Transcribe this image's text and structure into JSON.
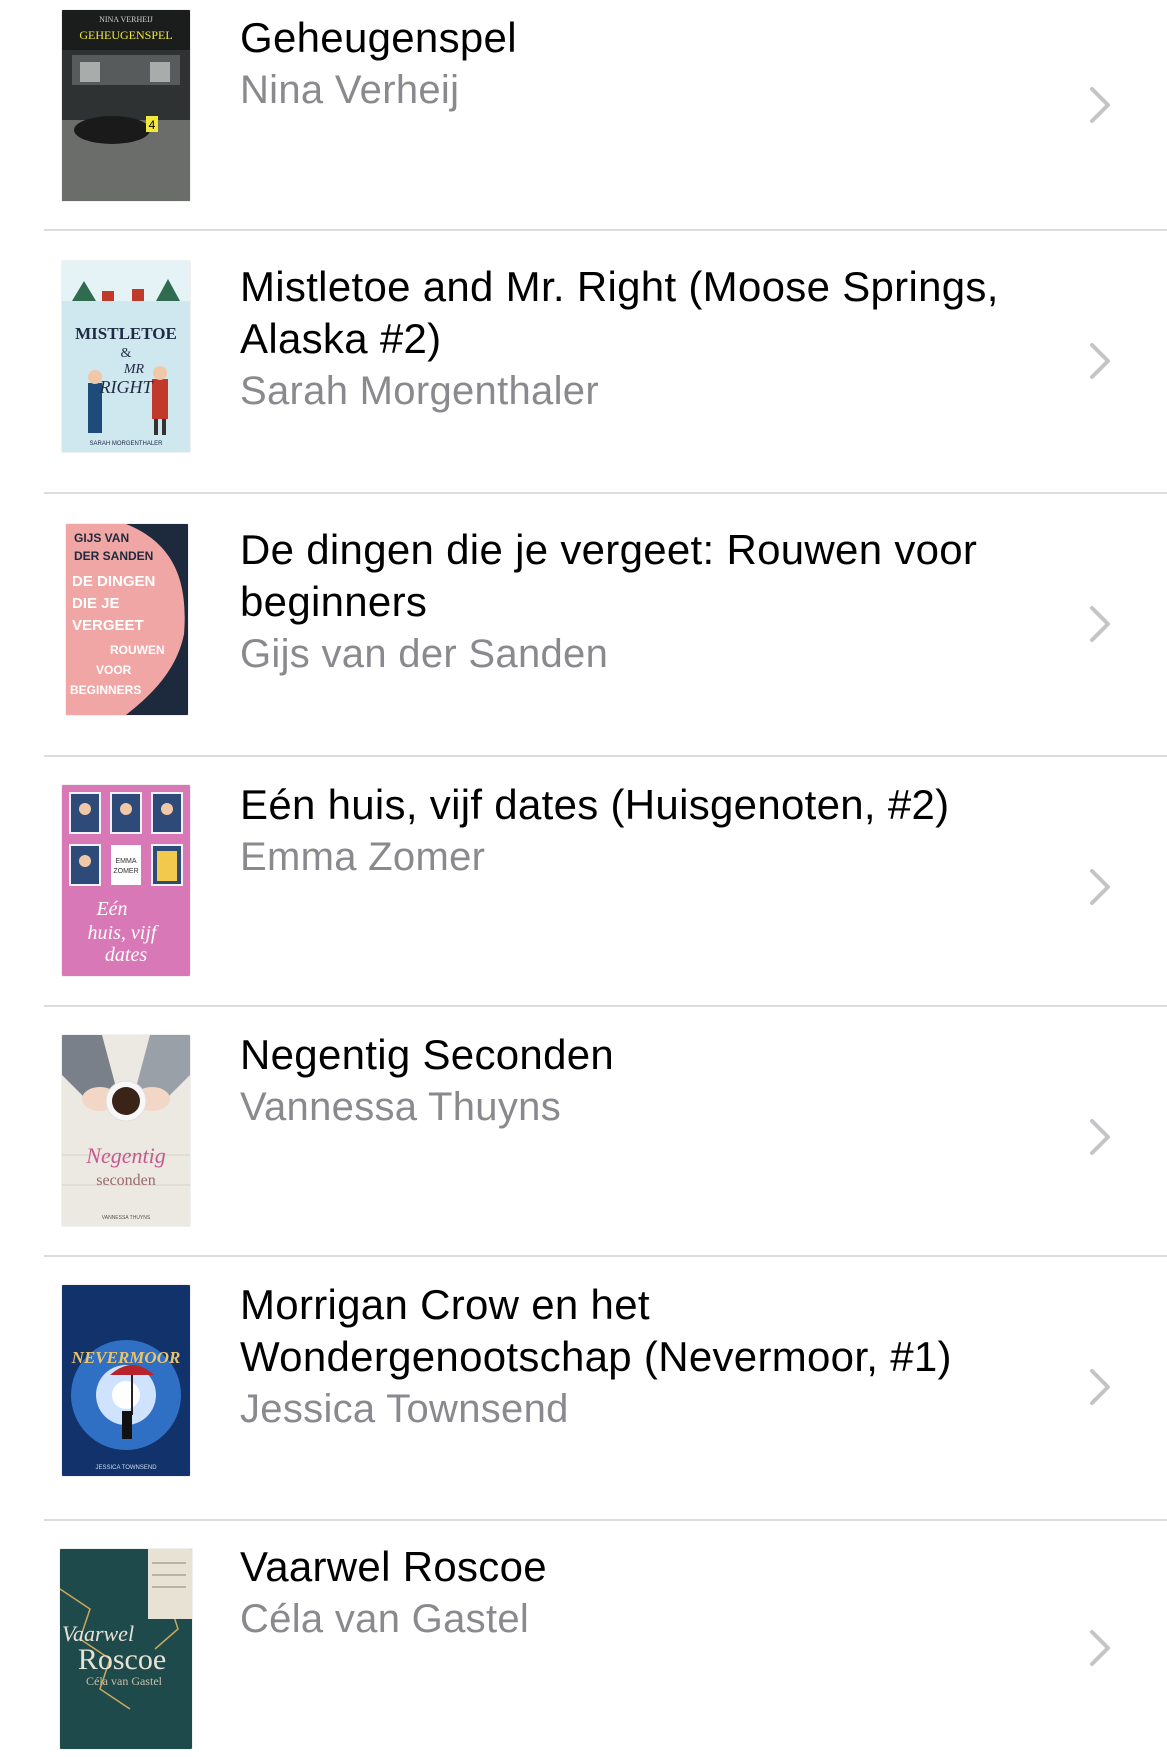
{
  "books": [
    {
      "title": "Geheugenspel",
      "author": "Nina Verheij",
      "cover": {
        "text_lines": [
          "NINA VERHEIJ",
          "GEHEUGENSPEL",
          "4"
        ],
        "colors": [
          "#3d4040",
          "#f2e93a"
        ]
      }
    },
    {
      "title": "Mistletoe and Mr. Right (Moose Springs, Alaska #2)",
      "author": "Sarah Morgenthaler",
      "cover": {
        "text_lines": [
          "MISTLETOE",
          "&",
          "MR",
          "RIGHT",
          "SARAH MORGENTHALER"
        ],
        "colors": [
          "#cfe7ee",
          "#c0392b"
        ]
      }
    },
    {
      "title": "De dingen die je vergeet: Rouwen voor beginners",
      "author": "Gijs van der Sanden",
      "cover": {
        "text_lines": [
          "GIJS VAN",
          "DER SANDEN",
          "DE DINGEN",
          "DIE JE",
          "VERGEET",
          "ROUWEN",
          "VOOR",
          "BEGINNERS"
        ],
        "colors": [
          "#f0a6a4",
          "#1d2a3d"
        ]
      }
    },
    {
      "title": "Eén huis, vijf dates (Huisgenoten, #2)",
      "author": "Emma Zomer",
      "cover": {
        "text_lines": [
          "EMMA",
          "ZOMER",
          "Eén",
          "huis, vijf",
          "dates"
        ],
        "colors": [
          "#d978b6",
          "#ffffff"
        ]
      }
    },
    {
      "title": "Negentig Seconden",
      "author": "Vannessa Thuyns",
      "cover": {
        "text_lines": [
          "Negentig",
          "seconden",
          "VANNESSA THUYNS"
        ],
        "colors": [
          "#ece8e2",
          "#c65a8e"
        ]
      }
    },
    {
      "title": "Morrigan Crow en het Wondergenootschap (Nevermoor, #1)",
      "author": "Jessica Townsend",
      "cover": {
        "text_lines": [
          "NEVERMOOR",
          "JESSICA TOWNSEND"
        ],
        "colors": [
          "#1d4f9c",
          "#e9c46a"
        ]
      }
    },
    {
      "title": "Vaarwel Roscoe",
      "author": "Céla van Gastel",
      "cover": {
        "text_lines": [
          "Vaarwel",
          "Roscoe",
          "Céla van Gastel"
        ],
        "colors": [
          "#1f4a4c",
          "#e8e2d4"
        ]
      }
    }
  ],
  "icons": {
    "row_chevron": "chevron-right-icon"
  },
  "colors": {
    "title": "#000000",
    "author": "#8a8a8e",
    "separator": "#dcdcdf",
    "chevron": "#c4c4c7"
  }
}
